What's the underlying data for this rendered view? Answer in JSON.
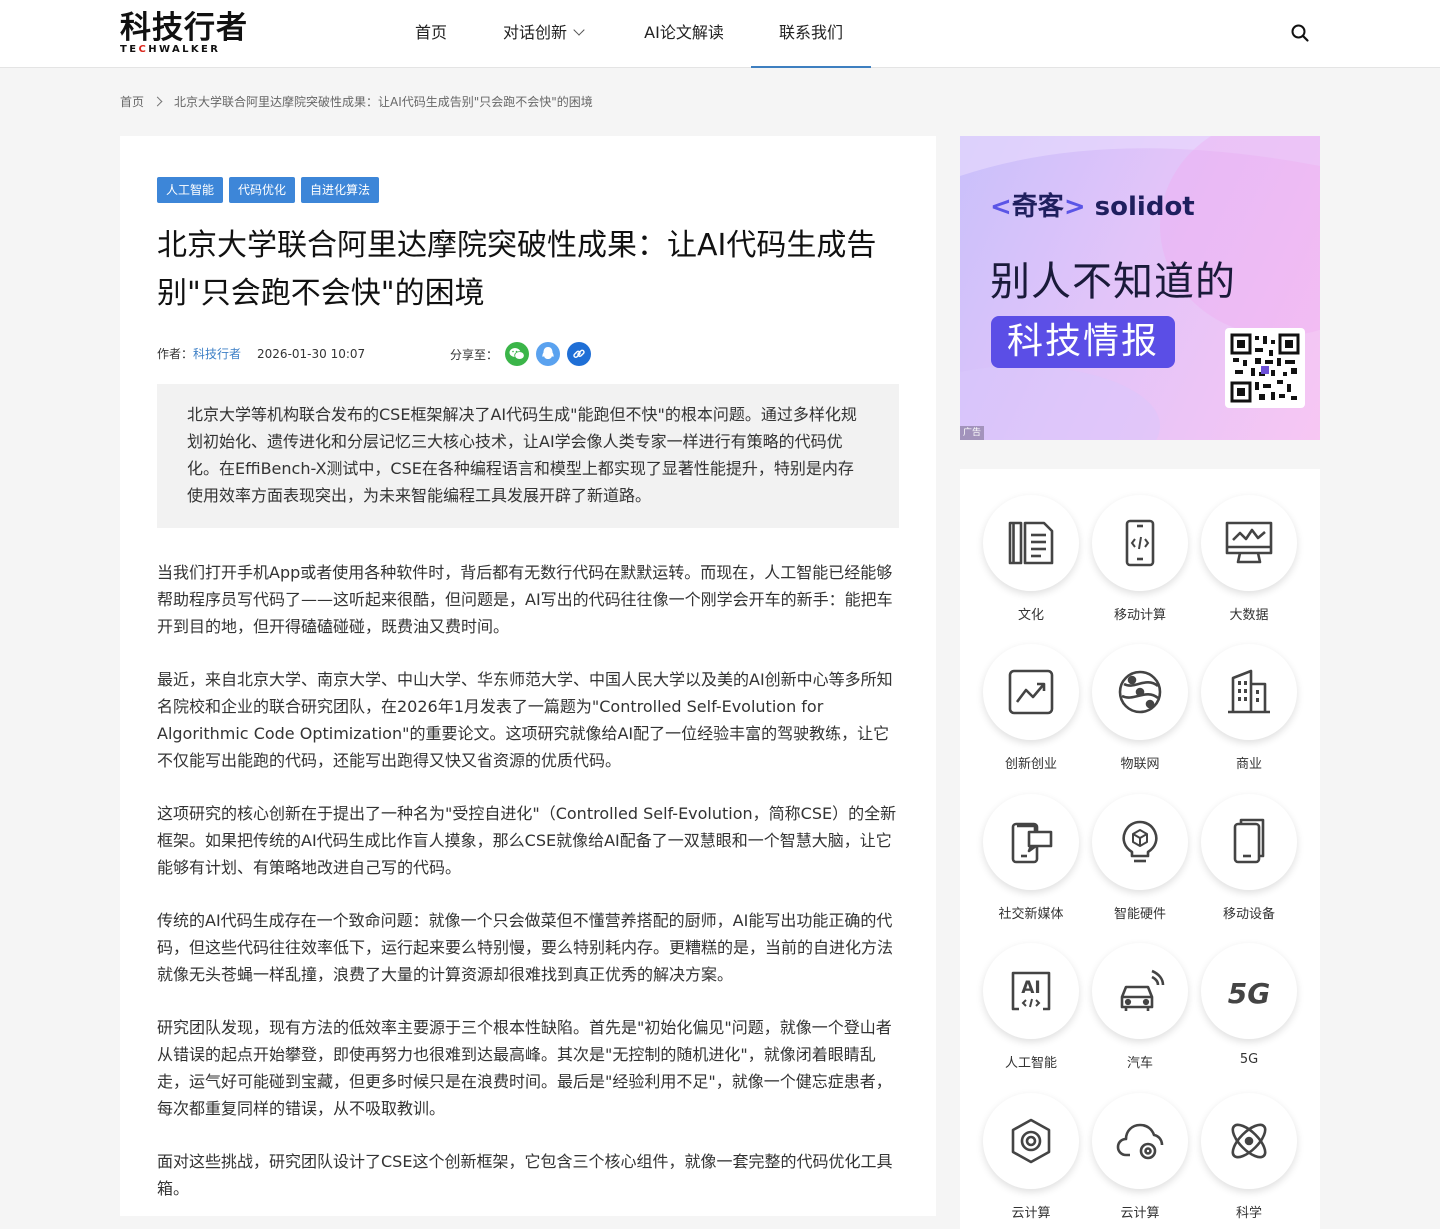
{
  "header": {
    "logo_cn": "科技行者",
    "logo_en_a": "TE",
    "logo_en_b": "C",
    "logo_en_c": "HWALKER",
    "nav": [
      {
        "label": "首页"
      },
      {
        "label": "对话创新"
      },
      {
        "label": "AI论文解读"
      },
      {
        "label": "联系我们"
      }
    ],
    "active_nav": "联系我们"
  },
  "breadcrumb": {
    "home": "首页",
    "current": "北京大学联合阿里达摩院突破性成果：让AI代码生成告别\"只会跑不会快\"的困境"
  },
  "article": {
    "tags": [
      "人工智能",
      "代码优化",
      "自进化算法"
    ],
    "title": "北京大学联合阿里达摩院突破性成果：让AI代码生成告别\"只会跑不会快\"的困境",
    "author_label": "作者：",
    "author": "科技行者",
    "date": "2026-01-30 10:07",
    "share_label": "分享至：",
    "summary": "北京大学等机构联合发布的CSE框架解决了AI代码生成\"能跑但不快\"的根本问题。通过多样化规划初始化、遗传进化和分层记忆三大核心技术，让AI学会像人类专家一样进行有策略的代码优化。在EffiBench-X测试中，CSE在各种编程语言和模型上都实现了显著性能提升，特别是内存使用效率方面表现突出，为未来智能编程工具发展开辟了新道路。",
    "paragraphs": [
      "当我们打开手机App或者使用各种软件时，背后都有无数行代码在默默运转。而现在，人工智能已经能够帮助程序员写代码了——这听起来很酷，但问题是，AI写出的代码往往像一个刚学会开车的新手：能把车开到目的地，但开得磕磕碰碰，既费油又费时间。",
      "最近，来自北京大学、南京大学、中山大学、华东师范大学、中国人民大学以及美的AI创新中心等多所知名院校和企业的联合研究团队，在2026年1月发表了一篇题为\"Controlled Self-Evolution for Algorithmic Code Optimization\"的重要论文。这项研究就像给AI配了一位经验丰富的驾驶教练，让它不仅能写出能跑的代码，还能写出跑得又快又省资源的优质代码。",
      "这项研究的核心创新在于提出了一种名为\"受控自进化\"（Controlled Self-Evolution，简称CSE）的全新框架。如果把传统的AI代码生成比作盲人摸象，那么CSE就像给AI配备了一双慧眼和一个智慧大脑，让它能够有计划、有策略地改进自己写的代码。",
      "传统的AI代码生成存在一个致命问题：就像一个只会做菜但不懂营养搭配的厨师，AI能写出功能正确的代码，但这些代码往往效率低下，运行起来要么特别慢，要么特别耗内存。更糟糕的是，当前的自进化方法就像无头苍蝇一样乱撞，浪费了大量的计算资源却很难找到真正优秀的解决方案。",
      "研究团队发现，现有方法的低效率主要源于三个根本性缺陷。首先是\"初始化偏见\"问题，就像一个登山者从错误的起点开始攀登，即使再努力也很难到达最高峰。其次是\"无控制的随机进化\"，就像闭着眼睛乱走，运气好可能碰到宝藏，但更多时候只是在浪费时间。最后是\"经验利用不足\"，就像一个健忘症患者，每次都重复同样的错误，从不吸取教训。",
      "面对这些挑战，研究团队设计了CSE这个创新框架，它包含三个核心组件，就像一套完整的代码优化工具箱。"
    ]
  },
  "ad": {
    "brand_cn": "奇客",
    "brand_en": "solidot",
    "headline": "别人不知道的",
    "pill": "科技情报",
    "label": "广告"
  },
  "categories": [
    {
      "label": "文化",
      "icon": "book-icon"
    },
    {
      "label": "移动计算",
      "icon": "phone-code-icon"
    },
    {
      "label": "大数据",
      "icon": "monitor-chart-icon"
    },
    {
      "label": "创新创业",
      "icon": "trend-chart-icon"
    },
    {
      "label": "物联网",
      "icon": "globe-network-icon"
    },
    {
      "label": "商业",
      "icon": "building-icon"
    },
    {
      "label": "社交新媒体",
      "icon": "social-media-icon"
    },
    {
      "label": "智能硬件",
      "icon": "lightbulb-cube-icon"
    },
    {
      "label": "移动设备",
      "icon": "mobile-device-icon"
    },
    {
      "label": "人工智能",
      "icon": "ai-chip-icon"
    },
    {
      "label": "汽车",
      "icon": "car-icon"
    },
    {
      "label": "5G",
      "icon": "5g-icon"
    },
    {
      "label": "云计算",
      "icon": "gear-hexagon-icon"
    },
    {
      "label": "云计算",
      "icon": "cloud-gear-icon"
    },
    {
      "label": "科学",
      "icon": "atom-icon"
    }
  ],
  "colors": {
    "accent": "#3e7fc0",
    "tag_bg": "#3d86d8",
    "wechat": "#3bb549",
    "qq": "#5aa2ef",
    "link": "#1f6fd6"
  }
}
